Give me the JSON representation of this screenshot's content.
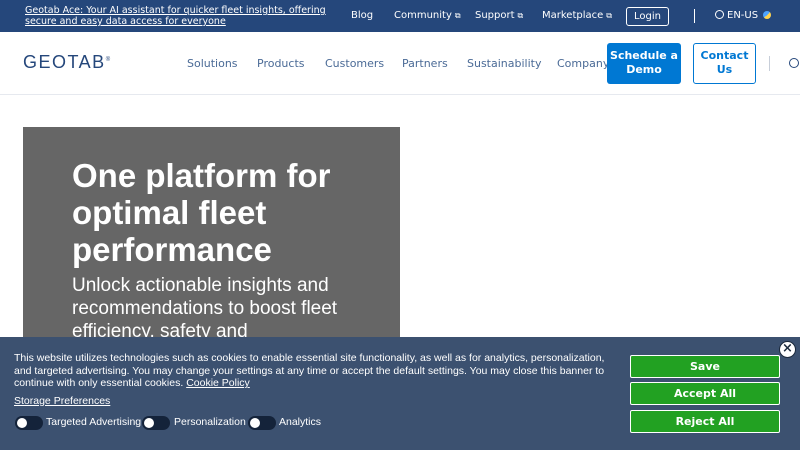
{
  "topbar": {
    "promo_text": "Geotab Ace: Your AI assistant for quicker fleet insights, offering secure and easy data access for everyone",
    "links": [
      {
        "label": "Blog",
        "external": false
      },
      {
        "label": "Community",
        "external": true
      },
      {
        "label": "Support",
        "external": true
      },
      {
        "label": "Marketplace",
        "external": true
      }
    ],
    "login_label": "Login",
    "language": "EN-US"
  },
  "nav": {
    "logo": "GEOTAB",
    "items": [
      "Solutions",
      "Products",
      "Customers",
      "Partners",
      "Sustainability",
      "Company"
    ],
    "demo_label": "Schedule a Demo",
    "contact_label": "Contact Us"
  },
  "hero": {
    "title": "One platform for optimal fleet performance",
    "subtitle": "Unlock actionable insights and recommendations to boost fleet efficiency, safety and"
  },
  "cookie": {
    "message": "This website utilizes technologies such as cookies to enable essential site functionality, as well as for analytics, personalization, and targeted advertising. You may change your settings at any time or accept the default settings. You may close this banner to continue with only essential cookies.",
    "policy_link": "Cookie Policy",
    "preferences_link": "Storage Preferences",
    "toggles": [
      {
        "label": "Targeted Advertising",
        "on": false
      },
      {
        "label": "Personalization",
        "on": false
      },
      {
        "label": "Analytics",
        "on": false
      }
    ],
    "save_label": "Save",
    "accept_label": "Accept All",
    "reject_label": "Reject All",
    "close_symbol": "×"
  },
  "colors": {
    "brand_navy": "#25477b",
    "primary_blue": "#0078d3",
    "hero_gray": "#666666",
    "banner_bg": "#3c5170",
    "banner_button": "#22a122"
  }
}
